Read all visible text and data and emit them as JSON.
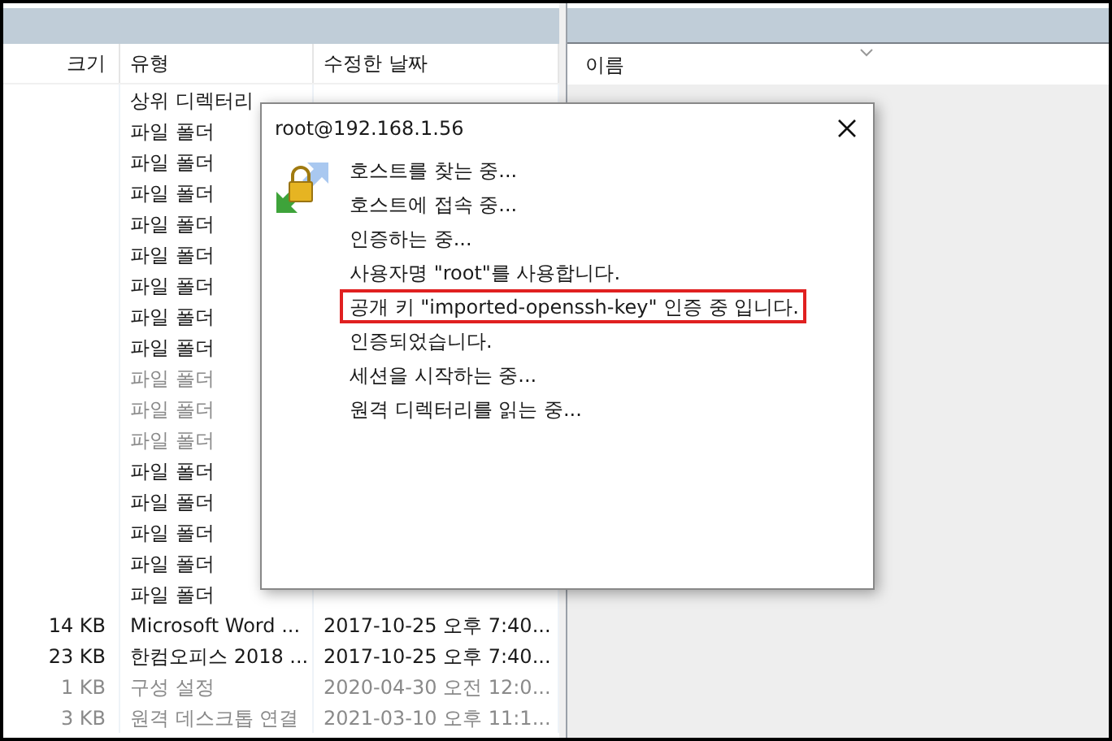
{
  "file_list": {
    "columns": [
      "크기",
      "유형",
      "수정한 날짜"
    ],
    "rows": [
      {
        "type": "상위 디렉터리",
        "dimmed": false
      },
      {
        "type": "파일 폴더",
        "dimmed": false
      },
      {
        "type": "파일 폴더",
        "dimmed": false
      },
      {
        "type": "파일 폴더",
        "dimmed": false
      },
      {
        "type": "파일 폴더",
        "dimmed": false
      },
      {
        "type": "파일 폴더",
        "dimmed": false
      },
      {
        "type": "파일 폴더",
        "dimmed": false
      },
      {
        "type": "파일 폴더",
        "dimmed": false
      },
      {
        "type": "파일 폴더",
        "dimmed": false
      },
      {
        "type": "파일 폴더",
        "dimmed": true
      },
      {
        "type": "파일 폴더",
        "dimmed": true
      },
      {
        "type": "파일 폴더",
        "dimmed": true
      },
      {
        "type": "파일 폴더",
        "dimmed": false
      },
      {
        "type": "파일 폴더",
        "dimmed": false
      },
      {
        "type": "파일 폴더",
        "dimmed": false
      },
      {
        "type": "파일 폴더",
        "dimmed": false
      },
      {
        "type": "파일 폴더",
        "dimmed": false
      },
      {
        "size": "14 KB",
        "type": "Microsoft Word ...",
        "modified": "2017-10-25 오후 7:40...",
        "dimmed": false
      },
      {
        "size": "23 KB",
        "type": "한컴오피스 2018 ...",
        "modified": "2017-10-25 오후 7:40...",
        "dimmed": false
      },
      {
        "size": "1 KB",
        "type": "구성 설정",
        "modified": "2020-04-30 오전 12:0...",
        "dimmed": true
      },
      {
        "size": "3 KB",
        "type": "원격 데스크톱 연결",
        "modified": "2021-03-10 오후 11:1...",
        "dimmed": true
      }
    ]
  },
  "remote_list": {
    "columns": [
      "이름"
    ]
  },
  "dialog": {
    "title": "root@192.168.1.56",
    "messages": [
      {
        "text": "호스트를 찾는 중...",
        "highlighted": false
      },
      {
        "text": "호스트에 접속 중...",
        "highlighted": false
      },
      {
        "text": "인증하는 중...",
        "highlighted": false
      },
      {
        "text": "사용자명 \"root\"를 사용합니다.",
        "highlighted": false
      },
      {
        "text": "공개 키 \"imported-openssh-key\" 인증 중 입니다.",
        "highlighted": true
      },
      {
        "text": "인증되었습니다.",
        "highlighted": false
      },
      {
        "text": "세션을 시작하는 중...",
        "highlighted": false
      },
      {
        "text": "원격 디렉터리를 읽는 중...",
        "highlighted": false
      }
    ]
  }
}
